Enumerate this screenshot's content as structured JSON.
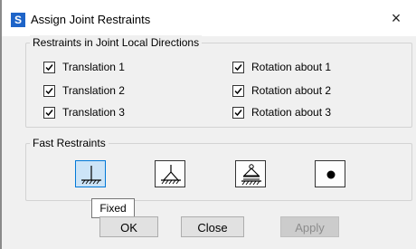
{
  "window": {
    "app_icon_letter": "S",
    "title": "Assign Joint Restraints",
    "close_glyph": "×"
  },
  "restraints": {
    "legend": "Restraints in Joint Local Directions",
    "items": [
      {
        "label": "Translation 1",
        "checked": true
      },
      {
        "label": "Translation 2",
        "checked": true
      },
      {
        "label": "Translation 3",
        "checked": true
      },
      {
        "label": "Rotation about 1",
        "checked": true
      },
      {
        "label": "Rotation about 2",
        "checked": true
      },
      {
        "label": "Rotation about 3",
        "checked": true
      }
    ]
  },
  "fast_restraints": {
    "legend": "Fast Restraints",
    "buttons": [
      {
        "name": "fixed",
        "icon": "fixed-support-icon",
        "active": true
      },
      {
        "name": "pinned",
        "icon": "pin-support-icon",
        "active": false
      },
      {
        "name": "roller",
        "icon": "roller-support-icon",
        "active": false
      },
      {
        "name": "free",
        "icon": "free-joint-icon",
        "active": false
      }
    ],
    "tooltip": "Fixed"
  },
  "actions": {
    "ok_label": "OK",
    "close_label": "Close",
    "apply_label": "Apply"
  },
  "colors": {
    "accent": "#0078d7",
    "app_icon": "#1e64c8",
    "dialog_bg": "#f0f0f0"
  }
}
